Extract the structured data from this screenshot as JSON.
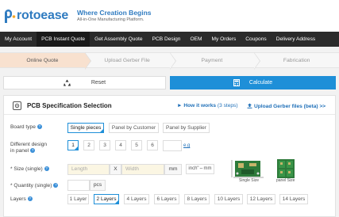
{
  "brand": {
    "name": "Protoease",
    "tagline": "Where Creation Begins",
    "subtagline": "All-in-One Manufacturing Platform."
  },
  "nav": {
    "items": [
      "My Account",
      "PCB Instant Quote",
      "Get Assembly Quote",
      "PCB Design",
      "OEM",
      "My Orders",
      "Coupons",
      "Delivery Address"
    ],
    "active": "PCB Instant Quote"
  },
  "steps": {
    "items": [
      "Online Quote",
      "Upload Gerber File",
      "Payment",
      "Fabrication"
    ],
    "active": "Online Quote"
  },
  "actions": {
    "reset_label": "Reset",
    "calculate_label": "Calculate"
  },
  "spec": {
    "title": "PCB Specification Selection",
    "how_it_works": "How it works",
    "how_it_works_steps": "(3 steps)",
    "upload_label": "Upload Gerber files (beta) >>"
  },
  "board_type": {
    "label": "Board type",
    "options": [
      "Single pieces",
      "Panel by Customer",
      "Panel by Supplier"
    ],
    "selected": "Single pieces"
  },
  "designs": {
    "label_line1": "Different design",
    "label_line2": "in panel",
    "options": [
      "1",
      "2",
      "3",
      "4",
      "5",
      "6"
    ],
    "selected": "1",
    "eg": "e.g"
  },
  "size": {
    "label": "* Size (single)",
    "length_placeholder": "Length",
    "separator": "X",
    "width_placeholder": "Width",
    "unit": "mm",
    "unit_toggle": "inch\"⇔mm",
    "single_size_label": "Single Size",
    "panel_size_label": "panel Size"
  },
  "quantity": {
    "label": "* Quantity (single)",
    "unit": "pcs"
  },
  "layers": {
    "label": "Layers",
    "options": [
      "1 Layer",
      "2 Layers",
      "4 Layers",
      "6 Layers",
      "8 Layers",
      "10 Layers",
      "12 Layers",
      "14 Layers"
    ],
    "selected": "2 Layers"
  },
  "colors": {
    "brand_blue": "#2f7bc0",
    "accent_blue": "#1e8fd8",
    "nav_bg": "#2b2b2b",
    "active_step": "#f8e1cf"
  }
}
